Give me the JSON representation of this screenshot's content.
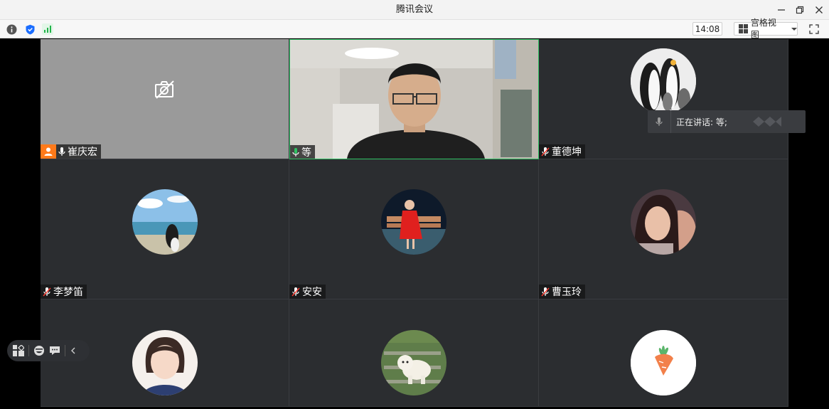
{
  "window": {
    "title": "腾讯会议"
  },
  "toolbar": {
    "time": "14:08",
    "view_label": "宫格视图"
  },
  "speaking": {
    "text": "正在讲话: 等;"
  },
  "participants": [
    {
      "name": "崔庆宏",
      "mic": "on",
      "camera": "off"
    },
    {
      "name": "等",
      "mic": "on",
      "camera": "on"
    },
    {
      "name": "董德坤",
      "mic": "muted",
      "camera": "off"
    },
    {
      "name": "李梦笛",
      "mic": "muted",
      "camera": "off"
    },
    {
      "name": "安安",
      "mic": "muted",
      "camera": "off"
    },
    {
      "name": "曹玉玲",
      "mic": "muted",
      "camera": "off"
    },
    {
      "name": "",
      "mic": "",
      "camera": "off"
    },
    {
      "name": "",
      "mic": "",
      "camera": "off"
    },
    {
      "name": "",
      "mic": "",
      "camera": "off"
    }
  ],
  "colors": {
    "tile_bg": "#2b2d30",
    "active_border": "#2fc163",
    "host_badge": "#ff7a1a",
    "mic_on": "#2fc163"
  }
}
